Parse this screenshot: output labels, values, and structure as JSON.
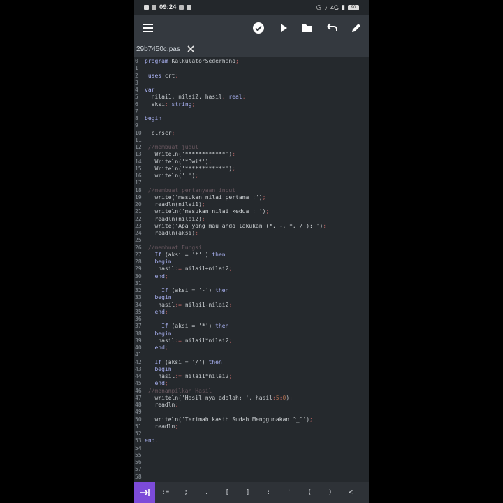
{
  "status_bar": {
    "time": "09:24",
    "left_icons": [
      "notification-icon",
      "notification-icon",
      "notification-icon",
      "facebook-icon"
    ],
    "more": "···",
    "network": "4G",
    "battery": "90"
  },
  "toolbar": {
    "icons": [
      "menu-icon",
      "compile-check-icon",
      "run-play-icon",
      "folder-icon",
      "undo-icon",
      "edit-pencil-icon"
    ]
  },
  "file_tab": {
    "filename": "29b7450c.pas"
  },
  "colors": {
    "background": "#25292d",
    "toolbar": "#34393f",
    "accent": "#7c4bd8",
    "keyword": "#a8b0f0",
    "comment": "#6a5860"
  },
  "code_lines": [
    {
      "n": "0",
      "t": [
        [
          "kw",
          "program "
        ],
        [
          "",
          "KalkulatorSederhana"
        ],
        [
          "pn",
          ";"
        ]
      ]
    },
    {
      "n": "1",
      "t": []
    },
    {
      "n": "2",
      "t": [
        [
          "kw",
          " uses "
        ],
        [
          "",
          "crt"
        ],
        [
          "pn",
          ";"
        ]
      ]
    },
    {
      "n": "3",
      "t": []
    },
    {
      "n": "4",
      "t": [
        [
          "kw",
          "var"
        ]
      ]
    },
    {
      "n": "5",
      "t": [
        [
          "",
          "  nilai1, nilai2, hasil"
        ],
        [
          "pn",
          ": "
        ],
        [
          "kw",
          "real"
        ],
        [
          "pn",
          ";"
        ]
      ]
    },
    {
      "n": "6",
      "t": [
        [
          "",
          "  aksi"
        ],
        [
          "pn",
          ": "
        ],
        [
          "kw",
          "string"
        ],
        [
          "pn",
          ";"
        ]
      ]
    },
    {
      "n": "7",
      "t": []
    },
    {
      "n": "8",
      "t": [
        [
          "kw",
          "begin"
        ]
      ]
    },
    {
      "n": "9",
      "t": []
    },
    {
      "n": "10",
      "t": [
        [
          "",
          "  clrscr"
        ],
        [
          "pn",
          ";"
        ]
      ]
    },
    {
      "n": "11",
      "t": []
    },
    {
      "n": "12",
      "t": [
        [
          "cm",
          " //membuat judul"
        ]
      ]
    },
    {
      "n": "13",
      "t": [
        [
          "",
          "   Writeln("
        ],
        [
          "str",
          "'************'"
        ],
        [
          "",
          ")"
        ],
        [
          "pn",
          ";"
        ]
      ]
    },
    {
      "n": "14",
      "t": [
        [
          "",
          "   Writeln("
        ],
        [
          "str",
          "'*Dwi*'"
        ],
        [
          "",
          ")"
        ],
        [
          "pn",
          ";"
        ]
      ]
    },
    {
      "n": "15",
      "t": [
        [
          "",
          "   Writeln("
        ],
        [
          "str",
          "'************'"
        ],
        [
          "",
          ")"
        ],
        [
          "pn",
          ";"
        ]
      ]
    },
    {
      "n": "16",
      "t": [
        [
          "",
          "   writeln("
        ],
        [
          "str",
          "' '"
        ],
        [
          "",
          ")"
        ],
        [
          "pn",
          ";"
        ]
      ]
    },
    {
      "n": "17",
      "t": []
    },
    {
      "n": "18",
      "t": [
        [
          "cm",
          " //membuat pertanyaan input"
        ]
      ]
    },
    {
      "n": "19",
      "t": [
        [
          "",
          "   write("
        ],
        [
          "str",
          "'masukan nilai pertama :'"
        ],
        [
          "",
          ")"
        ],
        [
          "pn",
          ";"
        ]
      ]
    },
    {
      "n": "20",
      "t": [
        [
          "",
          "   readln(nilai1)"
        ],
        [
          "pn",
          ";"
        ]
      ]
    },
    {
      "n": "21",
      "t": [
        [
          "",
          "   writeln("
        ],
        [
          "str",
          "'masukan nilai kedua : '"
        ],
        [
          "",
          ")"
        ],
        [
          "pn",
          ";"
        ]
      ]
    },
    {
      "n": "22",
      "t": [
        [
          "",
          "   readln(nilai2)"
        ],
        [
          "pn",
          ";"
        ]
      ]
    },
    {
      "n": "23",
      "t": [
        [
          "",
          "   write("
        ],
        [
          "str",
          "'Apa yang mau anda lakukan (*, -, *, / ): '"
        ],
        [
          "",
          ")"
        ],
        [
          "pn",
          ";"
        ]
      ]
    },
    {
      "n": "24",
      "t": [
        [
          "",
          "   readln(aksi)"
        ],
        [
          "pn",
          ";"
        ]
      ]
    },
    {
      "n": "25",
      "t": []
    },
    {
      "n": "26",
      "t": [
        [
          "cm",
          " //membuat Fungsi"
        ]
      ]
    },
    {
      "n": "27",
      "t": [
        [
          "kw",
          "   If "
        ],
        [
          "",
          "(aksi = "
        ],
        [
          "str",
          "'*'"
        ],
        [
          "",
          " ) "
        ],
        [
          "kw",
          "then"
        ]
      ]
    },
    {
      "n": "28",
      "t": [
        [
          "kw",
          "   begin"
        ]
      ]
    },
    {
      "n": "29",
      "t": [
        [
          "",
          "    hasil"
        ],
        [
          "pn",
          ":= "
        ],
        [
          "",
          "nilai1+nilai2"
        ],
        [
          "pn",
          ";"
        ]
      ]
    },
    {
      "n": "30",
      "t": [
        [
          "kw",
          "   end"
        ],
        [
          "pn",
          ";"
        ]
      ]
    },
    {
      "n": "31",
      "t": []
    },
    {
      "n": "32",
      "t": [
        [
          "kw",
          "     If "
        ],
        [
          "",
          "(aksi = "
        ],
        [
          "str",
          "'-'"
        ],
        [
          "",
          ") "
        ],
        [
          "kw",
          "then"
        ]
      ]
    },
    {
      "n": "33",
      "t": [
        [
          "kw",
          "   begin"
        ]
      ]
    },
    {
      "n": "34",
      "t": [
        [
          "",
          "    hasil"
        ],
        [
          "pn",
          ":= "
        ],
        [
          "",
          "nilai1-nilai2"
        ],
        [
          "pn",
          ";"
        ]
      ]
    },
    {
      "n": "35",
      "t": [
        [
          "kw",
          "   end"
        ],
        [
          "pn",
          ";"
        ]
      ]
    },
    {
      "n": "36",
      "t": []
    },
    {
      "n": "37",
      "t": [
        [
          "kw",
          "     If "
        ],
        [
          "",
          "(aksi = "
        ],
        [
          "str",
          "'*'"
        ],
        [
          "",
          ") "
        ],
        [
          "kw",
          "then"
        ]
      ]
    },
    {
      "n": "38",
      "t": [
        [
          "kw",
          "   begin"
        ]
      ]
    },
    {
      "n": "39",
      "t": [
        [
          "",
          "    hasil"
        ],
        [
          "pn",
          ":= "
        ],
        [
          "",
          "nilai1*nilai2"
        ],
        [
          "pn",
          ";"
        ]
      ]
    },
    {
      "n": "40",
      "t": [
        [
          "kw",
          "   end"
        ],
        [
          "pn",
          ";"
        ]
      ]
    },
    {
      "n": "41",
      "t": []
    },
    {
      "n": "42",
      "t": [
        [
          "kw",
          "   If "
        ],
        [
          "",
          "(aksi = "
        ],
        [
          "str",
          "'/'"
        ],
        [
          "",
          ") "
        ],
        [
          "kw",
          "then"
        ]
      ]
    },
    {
      "n": "43",
      "t": [
        [
          "kw",
          "   begin"
        ]
      ]
    },
    {
      "n": "44",
      "t": [
        [
          "",
          "    hasil"
        ],
        [
          "pn",
          ":= "
        ],
        [
          "",
          "nilai1*nilai2"
        ],
        [
          "pn",
          ";"
        ]
      ]
    },
    {
      "n": "45",
      "t": [
        [
          "kw",
          "   end"
        ],
        [
          "pn",
          ";"
        ]
      ]
    },
    {
      "n": "46",
      "t": [
        [
          "cm",
          " //menampilkan Hasil"
        ]
      ]
    },
    {
      "n": "47",
      "t": [
        [
          "",
          "   writeln("
        ],
        [
          "str",
          "'Hasil nya adalah: '"
        ],
        [
          "",
          ", hasil"
        ],
        [
          "pn",
          ":"
        ],
        [
          "num",
          "5"
        ],
        [
          "pn",
          ":"
        ],
        [
          "num",
          "0"
        ],
        [
          "",
          ")"
        ],
        [
          "pn",
          ";"
        ]
      ]
    },
    {
      "n": "48",
      "t": [
        [
          "",
          "   readln"
        ],
        [
          "pn",
          ";"
        ]
      ]
    },
    {
      "n": "49",
      "t": []
    },
    {
      "n": "50",
      "t": [
        [
          "",
          "   writeln("
        ],
        [
          "str",
          "'Terimah kasih Sudah Menggunakan ^_^'"
        ],
        [
          "",
          ")"
        ],
        [
          "pn",
          ";"
        ]
      ]
    },
    {
      "n": "51",
      "t": [
        [
          "",
          "   readln"
        ],
        [
          "pn",
          ";"
        ]
      ]
    },
    {
      "n": "52",
      "t": []
    },
    {
      "n": "53",
      "t": [
        [
          "kw",
          "end"
        ],
        [
          "pn",
          "."
        ]
      ]
    },
    {
      "n": "54",
      "t": []
    },
    {
      "n": "55",
      "t": []
    },
    {
      "n": "56",
      "t": []
    },
    {
      "n": "57",
      "t": []
    },
    {
      "n": "58",
      "t": []
    }
  ],
  "key_bar": {
    "keys": [
      ":=",
      ";",
      ".",
      "[",
      "]",
      ":",
      "'",
      "(",
      ")",
      "<"
    ]
  }
}
